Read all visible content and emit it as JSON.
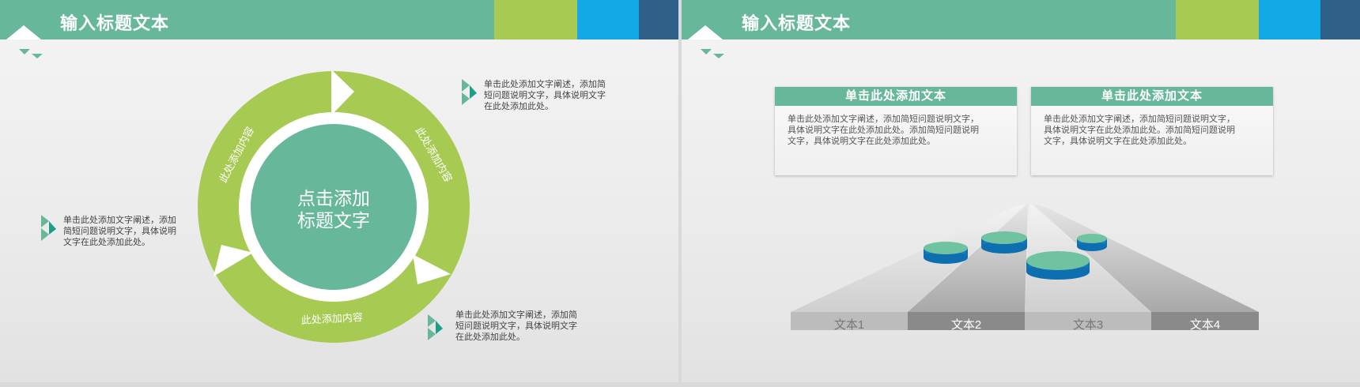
{
  "slide1": {
    "header": {
      "title": "输入标题文本"
    },
    "center_title": [
      "点击添加",
      "标题文字"
    ],
    "arc_labels": [
      "此处添加内容",
      "此处添加内容",
      "此处添加内容"
    ],
    "notes": [
      [
        "单击此处添加文字阐述，添加简",
        "短问题说明文字，具体说明文字",
        "在此处添加此处。"
      ],
      [
        "单击此处添加文字阐述，添加",
        "简短问题说明文字，具体说明",
        "文字在此处添加此处。"
      ],
      [
        "单击此处添加文字阐述，添加简",
        "短问题说明文字，具体说明文字",
        "在此处添加此处。"
      ]
    ]
  },
  "slide2": {
    "header": {
      "title": "输入标题文本"
    },
    "boxes": [
      {
        "title": "单击此处添加文本",
        "lines": [
          "单击此处添加文字阐述，添加简短问题说明文字，",
          "具体说明文字在此处添加此处。添加简短问题说明",
          "文字，具体说明文字在此处添加此处。"
        ]
      },
      {
        "title": "单击此处添加文本",
        "lines": [
          "单击此处添加文字阐述，添加简短问题说明文字，",
          "具体说明文字在此处添加此处。添加简短问题说明",
          "文字，具体说明文字在此处添加此处。"
        ]
      }
    ],
    "lane_labels": [
      "文本1",
      "文本2",
      "文本3",
      "文本4"
    ]
  },
  "colors": {
    "green": "#67b89a",
    "lime": "#a7cb52",
    "blue": "#13a9e6",
    "navy": "#2e5f86"
  }
}
